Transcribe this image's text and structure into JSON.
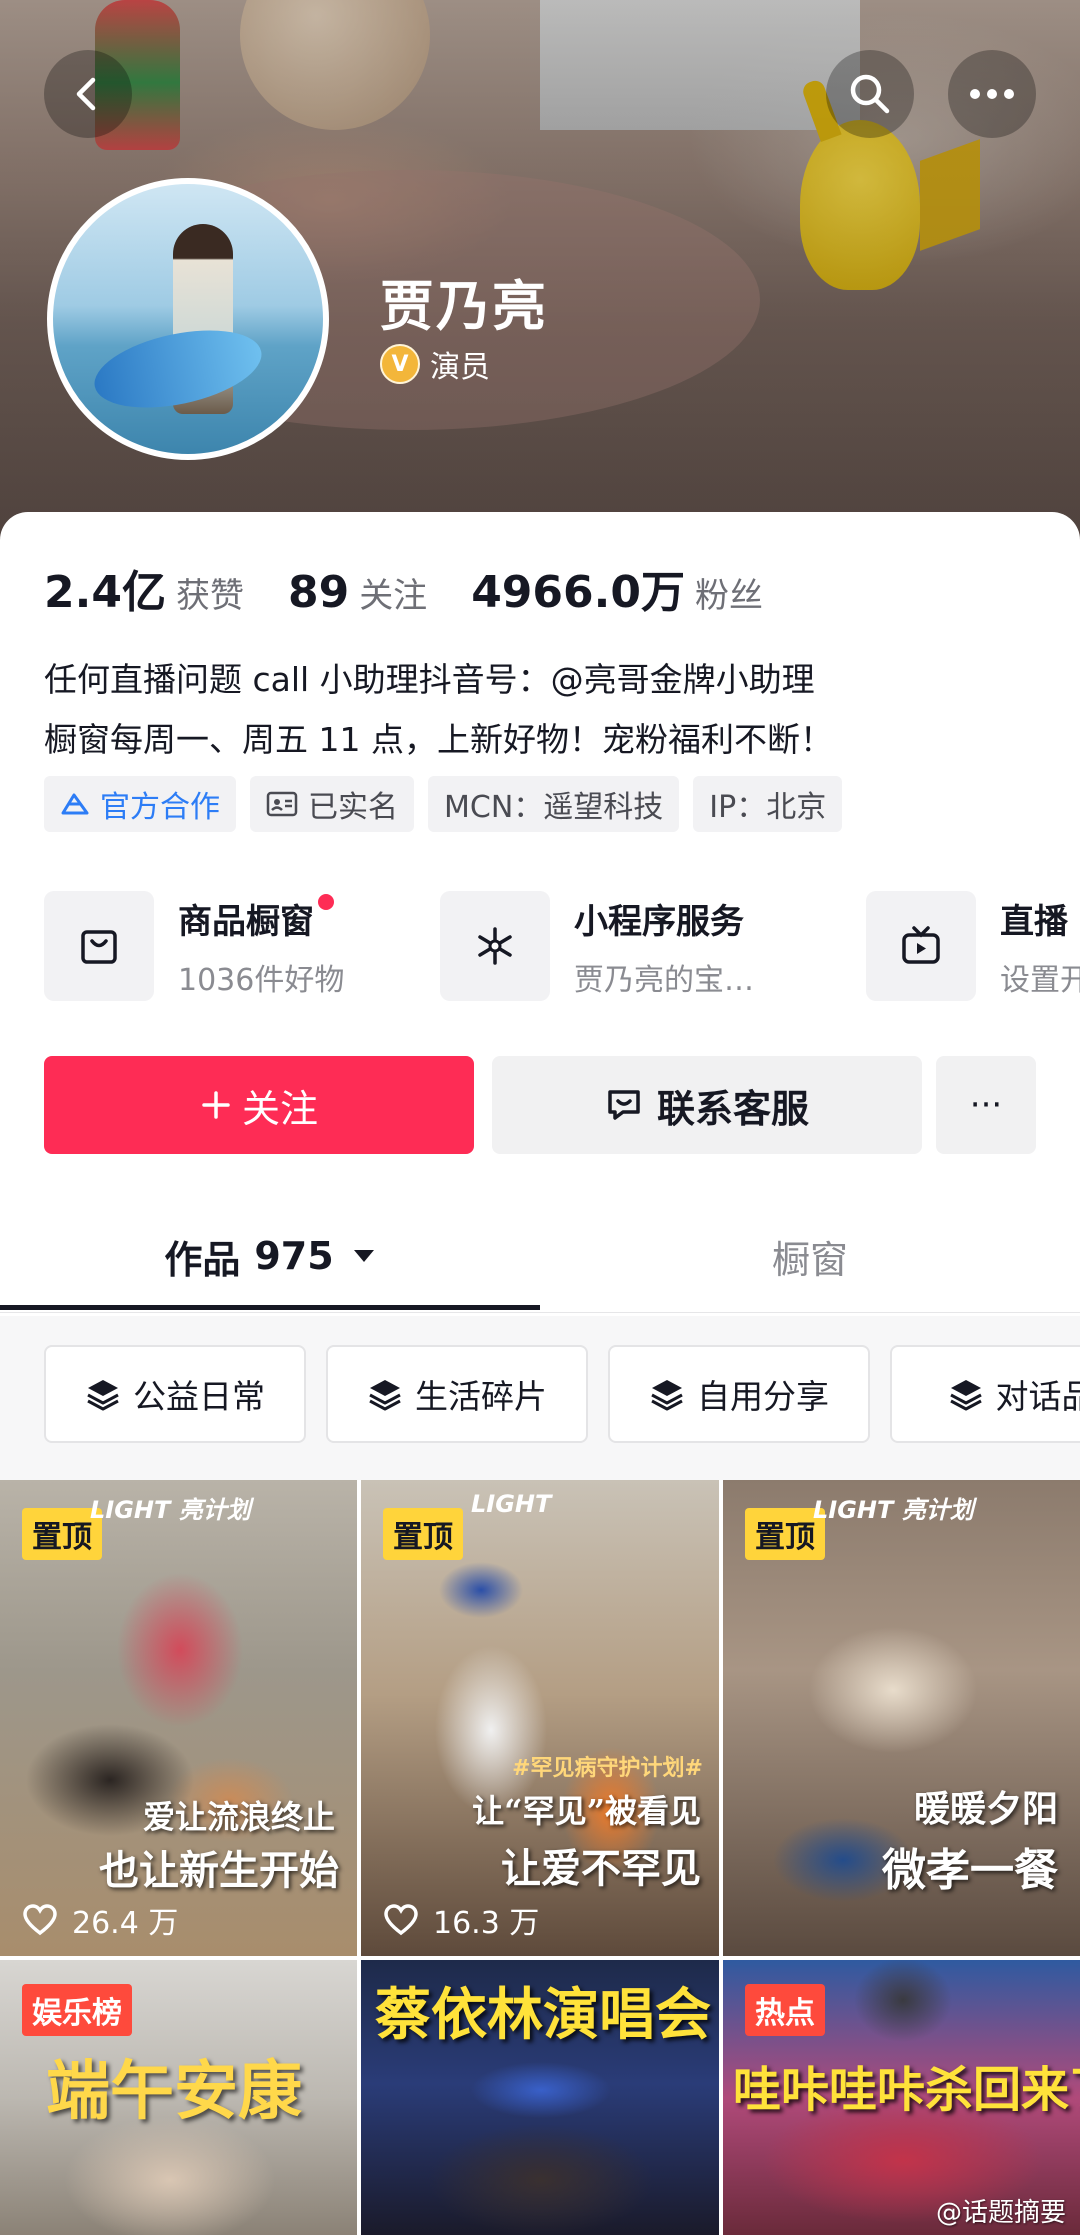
{
  "profile": {
    "name": "贾乃亮",
    "role": "演员",
    "verified_mark": "V"
  },
  "stats": [
    {
      "value": "2.4亿",
      "label": "获赞"
    },
    {
      "value": "89",
      "label": "关注"
    },
    {
      "value": "4966.0万",
      "label": "粉丝"
    }
  ],
  "bio": {
    "line1": "任何直播问题 call 小助理抖音号：@亮哥金牌小助理",
    "line2": "橱窗每周一、周五 11 点，上新好物！宠粉福利不断！"
  },
  "tags": {
    "official": "官方合作",
    "realname": "已实名",
    "mcn": "MCN：遥望科技",
    "ip": "IP：北京"
  },
  "services": [
    {
      "title": "商品橱窗",
      "subtitle": "1036件好物"
    },
    {
      "title": "小程序服务",
      "subtitle": "贾乃亮的宝…"
    },
    {
      "title": "直播",
      "subtitle": "设置开"
    }
  ],
  "actions": {
    "follow": "关注",
    "contact": "联系客服",
    "more": "···"
  },
  "tabs": {
    "works_label": "作品",
    "works_count": "975",
    "showcase": "橱窗"
  },
  "filters": [
    "公益日常",
    "生活碎片",
    "自用分享",
    "对话品"
  ],
  "videos": [
    {
      "badge": "置顶",
      "caption1": "爱让流浪终止",
      "caption2": "也让新生开始",
      "likes": "26.4 万",
      "brand": "LIGHT 亮计划"
    },
    {
      "badge": "置顶",
      "caption1": "让“罕见”被看见",
      "caption2": "让爱不罕见",
      "likes": "16.3 万",
      "brand": "LIGHT",
      "hashtag": "#罕见病守护计划#"
    },
    {
      "badge": "置顶",
      "caption1": "暖暖夕阳",
      "caption2": "微孝一餐",
      "likes": "",
      "brand": "LIGHT 亮计划"
    },
    {
      "badge": "娱乐榜",
      "caption1": "端午安康"
    },
    {
      "badge": "",
      "caption1": "蔡依林演唱会"
    },
    {
      "badge": "热点",
      "caption1": "哇咔哇咔杀回来了"
    }
  ],
  "watermark": "@话题摘要",
  "colors": {
    "accent": "#fe2c55",
    "link_blue": "#2d7df6",
    "badge_yellow": "#ffd43b",
    "badge_red": "#fe4a3c"
  }
}
